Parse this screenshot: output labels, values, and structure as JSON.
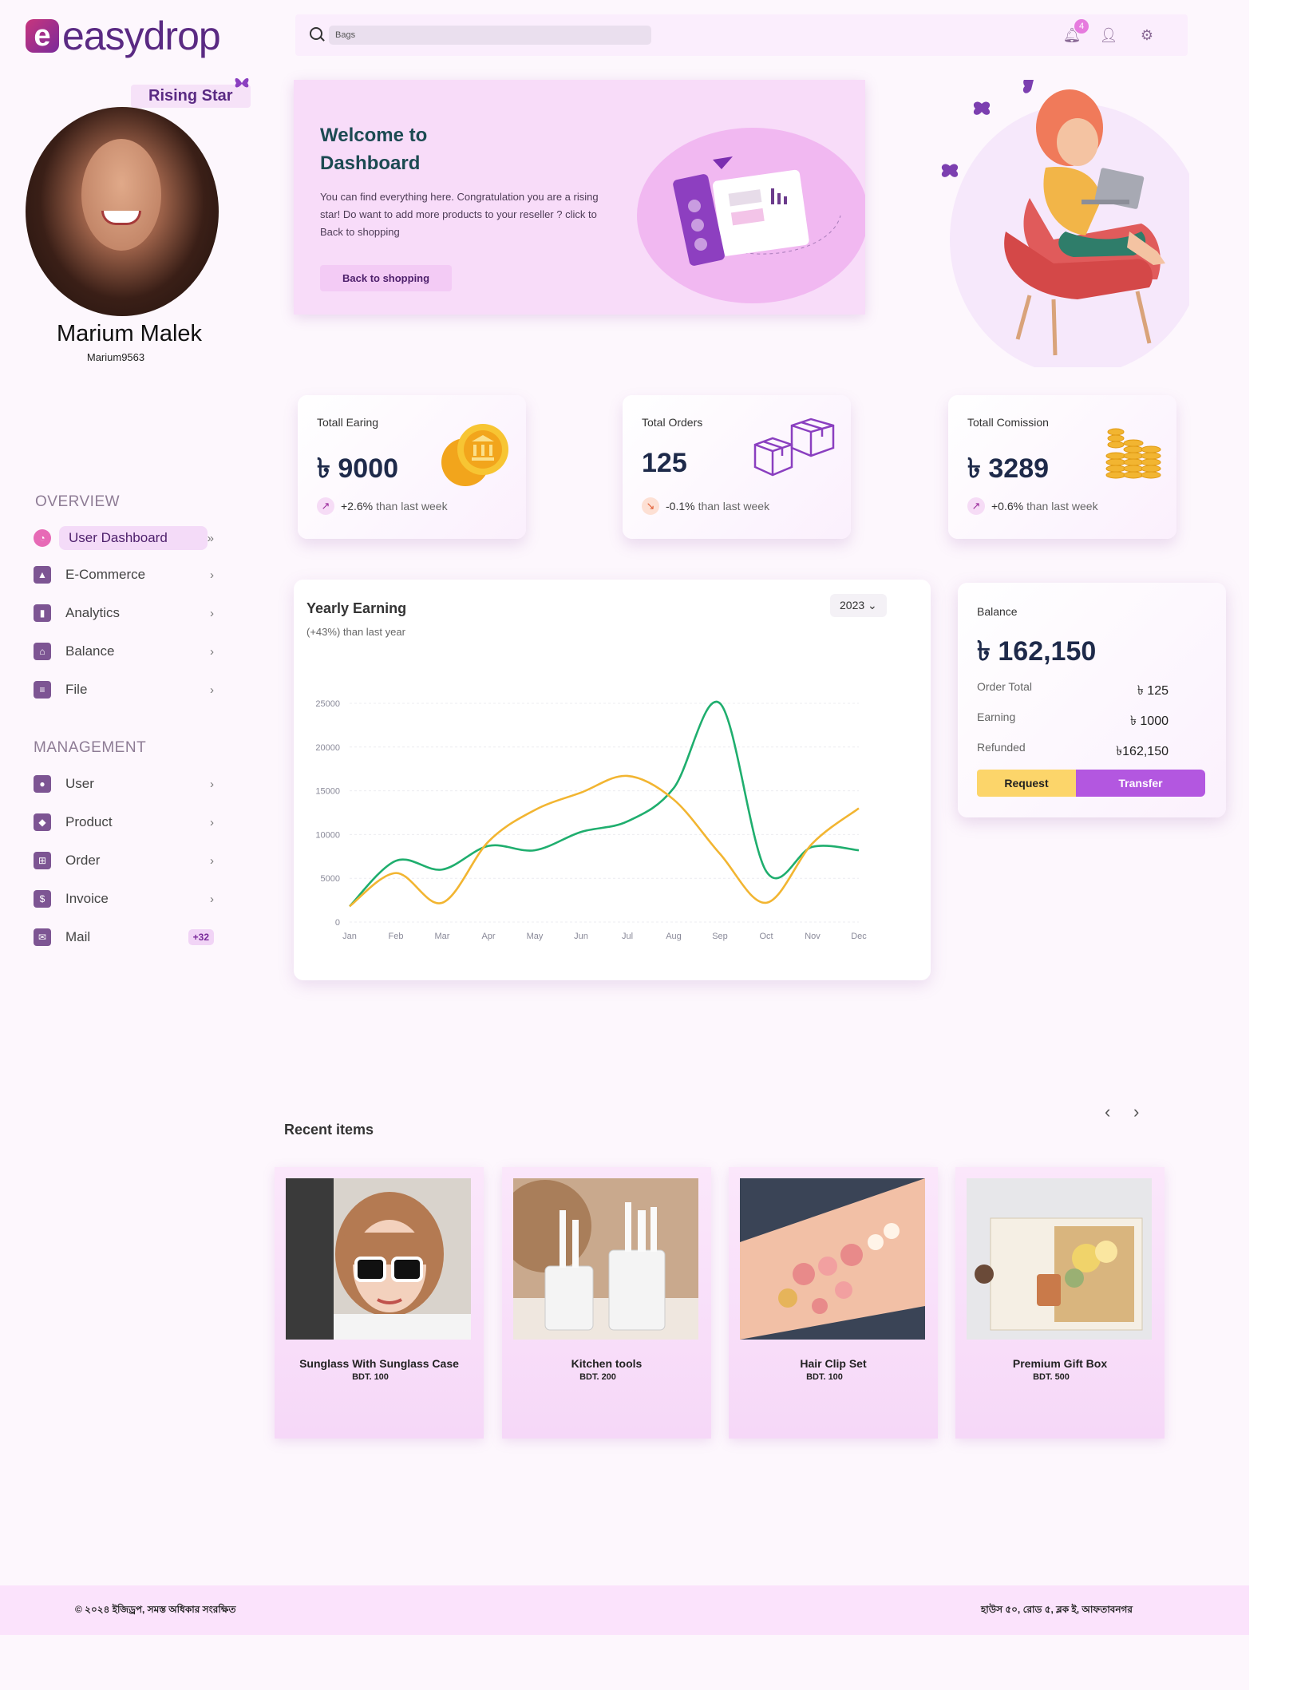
{
  "app": {
    "logo_text": "easydrop",
    "logo_mark": "e"
  },
  "profile": {
    "badge": "Rising Star",
    "name": "Marium Malek",
    "handle": "Marium9563"
  },
  "search": {
    "value": "Bags"
  },
  "notifications": {
    "count": "4"
  },
  "sidebar": {
    "overview_title": "OVERVIEW",
    "management_title": "MANAGEMENT",
    "overview_items": [
      {
        "label": "User Dashboard",
        "icon": "dashboard-gauge-icon",
        "active": true
      },
      {
        "label": "E-Commerce",
        "icon": "shopping-bag-icon"
      },
      {
        "label": "Analytics",
        "icon": "analytics-chart-icon"
      },
      {
        "label": "Balance",
        "icon": "bank-icon"
      },
      {
        "label": "File",
        "icon": "file-icon"
      }
    ],
    "management_items": [
      {
        "label": "User",
        "icon": "user-icon"
      },
      {
        "label": "Product",
        "icon": "product-box-icon"
      },
      {
        "label": "Order",
        "icon": "cart-icon"
      },
      {
        "label": "Invoice",
        "icon": "dollar-invoice-icon"
      },
      {
        "label": "Mail",
        "icon": "mail-icon",
        "badge": "+32"
      }
    ]
  },
  "welcome": {
    "title": "Welcome to Dashboard",
    "text": "You can find everything here. Congratulation you are a rising star!  Do want to add more products to your reseller ? click to Back to shopping",
    "button": "Back to shopping"
  },
  "stats": [
    {
      "title": "Totall Earing",
      "value": "৳ 9000",
      "change": "+2.6%",
      "suffix": "than last week",
      "trend": "up"
    },
    {
      "title": "Total Orders",
      "value": "125",
      "change": "-0.1%",
      "suffix": "than last week",
      "trend": "down"
    },
    {
      "title": "Totall Comission",
      "value": "৳ 3289",
      "change": "+0.6%",
      "suffix": "than last week",
      "trend": "up"
    }
  ],
  "yearly": {
    "title": "Yearly Earning",
    "subtitle": "(+43%) than last year",
    "year": "2023"
  },
  "chart_data": {
    "type": "line",
    "categories": [
      "Jan",
      "Feb",
      "Mar",
      "Apr",
      "May",
      "Jun",
      "Jul",
      "Aug",
      "Sep",
      "Oct",
      "Nov",
      "Dec"
    ],
    "ylim": [
      0,
      25000
    ],
    "yticks": [
      0,
      5000,
      10000,
      15000,
      20000,
      25000
    ],
    "grid": true,
    "series": [
      {
        "color": "#1fae6e",
        "values": [
          1800,
          7000,
          6000,
          8700,
          8200,
          10300,
          11500,
          15300,
          25000,
          5800,
          8600,
          8200
        ]
      },
      {
        "color": "#f2b531",
        "values": [
          1800,
          5600,
          2200,
          9200,
          12800,
          14800,
          16700,
          14000,
          7800,
          2200,
          9000,
          13000
        ]
      }
    ]
  },
  "balance": {
    "title": "Balance",
    "value": "৳ 162,150",
    "rows": [
      {
        "label": "Order Total",
        "value": "৳ 125"
      },
      {
        "label": "Earning",
        "value": "৳ 1000"
      },
      {
        "label": "Refunded",
        "value": "৳162,150"
      }
    ],
    "request_button": "Request",
    "transfer_button": "Transfer"
  },
  "recent": {
    "title": "Recent items",
    "items": [
      {
        "name": "Sunglass With Sunglass Case",
        "price": "BDT. 100"
      },
      {
        "name": "Kitchen tools",
        "price": "BDT. 200"
      },
      {
        "name": "Hair Clip Set",
        "price": "BDT. 100"
      },
      {
        "name": "Premium Gift Box",
        "price": "BDT. 500"
      }
    ]
  },
  "footer": {
    "left": "© ২০২৪ ইজিড্রপ, সমস্ত অধিকার সংরক্ষিত",
    "right": "হাউস ৫০, রোড ৫, ব্লক ই, আফতাবনগর"
  }
}
